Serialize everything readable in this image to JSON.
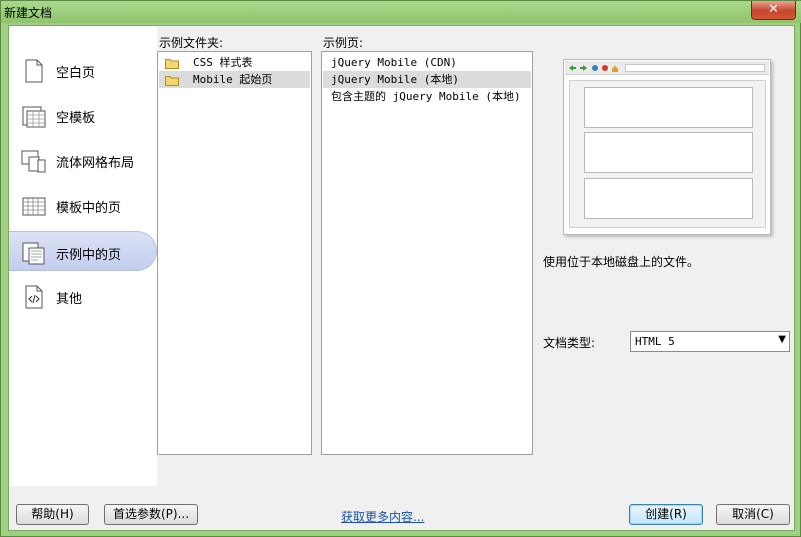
{
  "window": {
    "title": "新建文档",
    "close_icon": "close-icon"
  },
  "nav": {
    "items": [
      {
        "label": "空白页",
        "icon": "blank-page-icon",
        "active": false
      },
      {
        "label": "空模板",
        "icon": "template-icon",
        "active": false
      },
      {
        "label": "流体网格布局",
        "icon": "fluid-grid-icon",
        "active": false
      },
      {
        "label": "模板中的页",
        "icon": "page-from-template-icon",
        "active": false
      },
      {
        "label": "示例中的页",
        "icon": "page-from-sample-icon",
        "active": true
      },
      {
        "label": "其他",
        "icon": "code-file-icon",
        "active": false
      }
    ]
  },
  "sample_folders": {
    "label": "示例文件夹:",
    "items": [
      {
        "label": "CSS 样式表",
        "selected": false
      },
      {
        "label": "Mobile 起始页",
        "selected": true
      }
    ]
  },
  "sample_pages": {
    "label": "示例页:",
    "items": [
      {
        "label": "jQuery Mobile (CDN)",
        "selected": false
      },
      {
        "label": "jQuery Mobile (本地)",
        "selected": true
      },
      {
        "label": "包含主题的 jQuery Mobile (本地)",
        "selected": false
      }
    ]
  },
  "preview": {
    "description": "使用位于本地磁盘上的文件。"
  },
  "doctype": {
    "label": "文档类型:",
    "value": "HTML 5"
  },
  "footer": {
    "help": "帮助(H)",
    "preferences": "首选参数(P)...",
    "more_content": "获取更多内容...",
    "create": "创建(R)",
    "cancel": "取消(C)"
  },
  "colors": {
    "accent": "#c3cdee",
    "titlebar": "#9fcf80",
    "link": "#1d4fa8"
  }
}
